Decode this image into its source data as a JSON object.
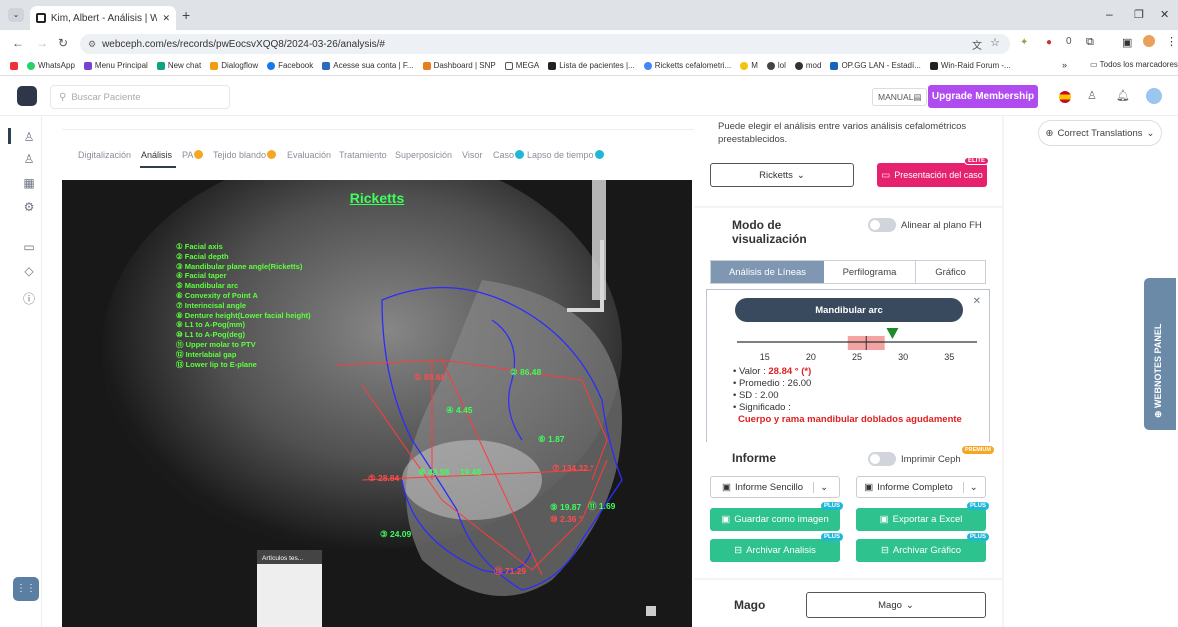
{
  "browser": {
    "tab_title": "Kim, Albert - Análisis | WebCeph",
    "url": "webceph.com/es/records/pwEocsvXQQ8/2024-03-26/analysis/#",
    "new_tab": "+",
    "window_controls": [
      "–",
      "❐",
      "✕"
    ],
    "bookmarks": [
      "WhatsApp",
      "Menu Principal",
      "New chat",
      "Dialogflow",
      "Facebook",
      "Acesse sua conta | F...",
      "Dashboard | SNP",
      "MEGA",
      "Lista de pacientes |...",
      "Ricketts cefalometri...",
      "M",
      "lol",
      "mod",
      "OP.GG LAN - Estadí...",
      "Win-Raid Forum -..."
    ],
    "bookmarks_more": "»",
    "all_bookmarks": "Todos los marcadores",
    "ext_count": "0"
  },
  "app": {
    "search_placeholder": "Buscar Paciente",
    "manual": "MANUAL",
    "upgrade": "Upgrade Membership",
    "correct_translations": "Correct Translations",
    "webnotes": "WEBNOTES PANEL"
  },
  "nav_tabs": [
    "Digitalización",
    "Análisis",
    "PA",
    "Tejido blando",
    "Evaluación",
    "Tratamiento",
    "Superposición",
    "Visor",
    "Caso",
    "Lapso de tiempo"
  ],
  "xray": {
    "title": "Ricketts",
    "legend": [
      "① Facial axis",
      "② Facial depth",
      "③ Mandibular plane angle(Ricketts)",
      "④ Facial taper",
      "⑤ Mandibular arc",
      "⑥ Convexity of Point A",
      "⑦ Interincisal angle",
      "⑧ Denture height(Lower facial height)",
      "⑨ L1 to A-Pog(mm)",
      "⑩ L1 to A-Pog(deg)",
      "⑪ Upper molar to PTV",
      "⑫ Interlabial gap",
      "⑬ Lower lip to E-plane"
    ],
    "measurements": [
      {
        "label": "① 89.68",
        "color": "#ff4d4d"
      },
      {
        "label": "② 86.48",
        "color": "#3dff5a"
      },
      {
        "label": "④ 4.45",
        "color": "#3dff5a"
      },
      {
        "label": "⑥ 1.87",
        "color": "#3dff5a"
      },
      {
        "label": "⑤ 28.84 °",
        "color": "#ff4d4d"
      },
      {
        "label": "⑧ 48.98",
        "color": "#3dff5a"
      },
      {
        "label": "19.48",
        "color": "#3dff5a"
      },
      {
        "label": "⑦ 134.32 °",
        "color": "#ff4d4d"
      },
      {
        "label": "⑨ 19.87",
        "color": "#3dff5a"
      },
      {
        "label": "⑪ 1.69",
        "color": "#3dff5a"
      },
      {
        "label": "⑩ 2.36 °",
        "color": "#ff4d4d"
      },
      {
        "label": "③ 24.09",
        "color": "#3dff5a"
      },
      {
        "label": "⑬ 71.29",
        "color": "#ff4d4d"
      }
    ],
    "thumbnail_title": "Artículos tes..."
  },
  "panel": {
    "intro": "Puede elegir el análisis entre varios análisis cefalométricos preestablecidos.",
    "analysis_select": "Ricketts",
    "presentation": "Presentación del caso",
    "elite": "ELITE",
    "display_mode": "Modo de visualización",
    "align_fh": "Alinear al plano FH",
    "view_tabs": [
      "Análisis de Líneas",
      "Perfilograma",
      "Gráfico"
    ],
    "gauge": {
      "title": "Mandibular arc",
      "ticks": [
        "15",
        "20",
        "25",
        "30",
        "35"
      ],
      "value_label": "• Valor :",
      "value": "28.84 ° (*)",
      "mean": "• Promedio : 26.00",
      "sd": "• SD : 2.00",
      "meaning_label": "• Significado :",
      "meaning": "Cuerpo y rama mandibular doblados agudamente",
      "axis_min": 12,
      "axis_max": 38,
      "mean_value": 26,
      "sd_value": 2,
      "marker_value": 28.84
    },
    "report": "Informe",
    "print_ceph": "Imprimir Ceph",
    "premium": "PREMIUM",
    "simple_report": "Informe Sencillo",
    "full_report": "Informe Completo",
    "save_image": "Guardar como imagen",
    "export_excel": "Exportar a Excel",
    "archive_analysis": "Archivar Analisis",
    "archive_graph": "Archivar Gráfico",
    "plus": "PLUS",
    "mago": "Mago",
    "mago_select": "Mago"
  },
  "colors": {
    "accent": "#2ec28f",
    "upgrade": "#b04bf0",
    "presentation": "#e6216e",
    "navy": "#3a4a5e",
    "link_blue": "#1fb7d6"
  }
}
